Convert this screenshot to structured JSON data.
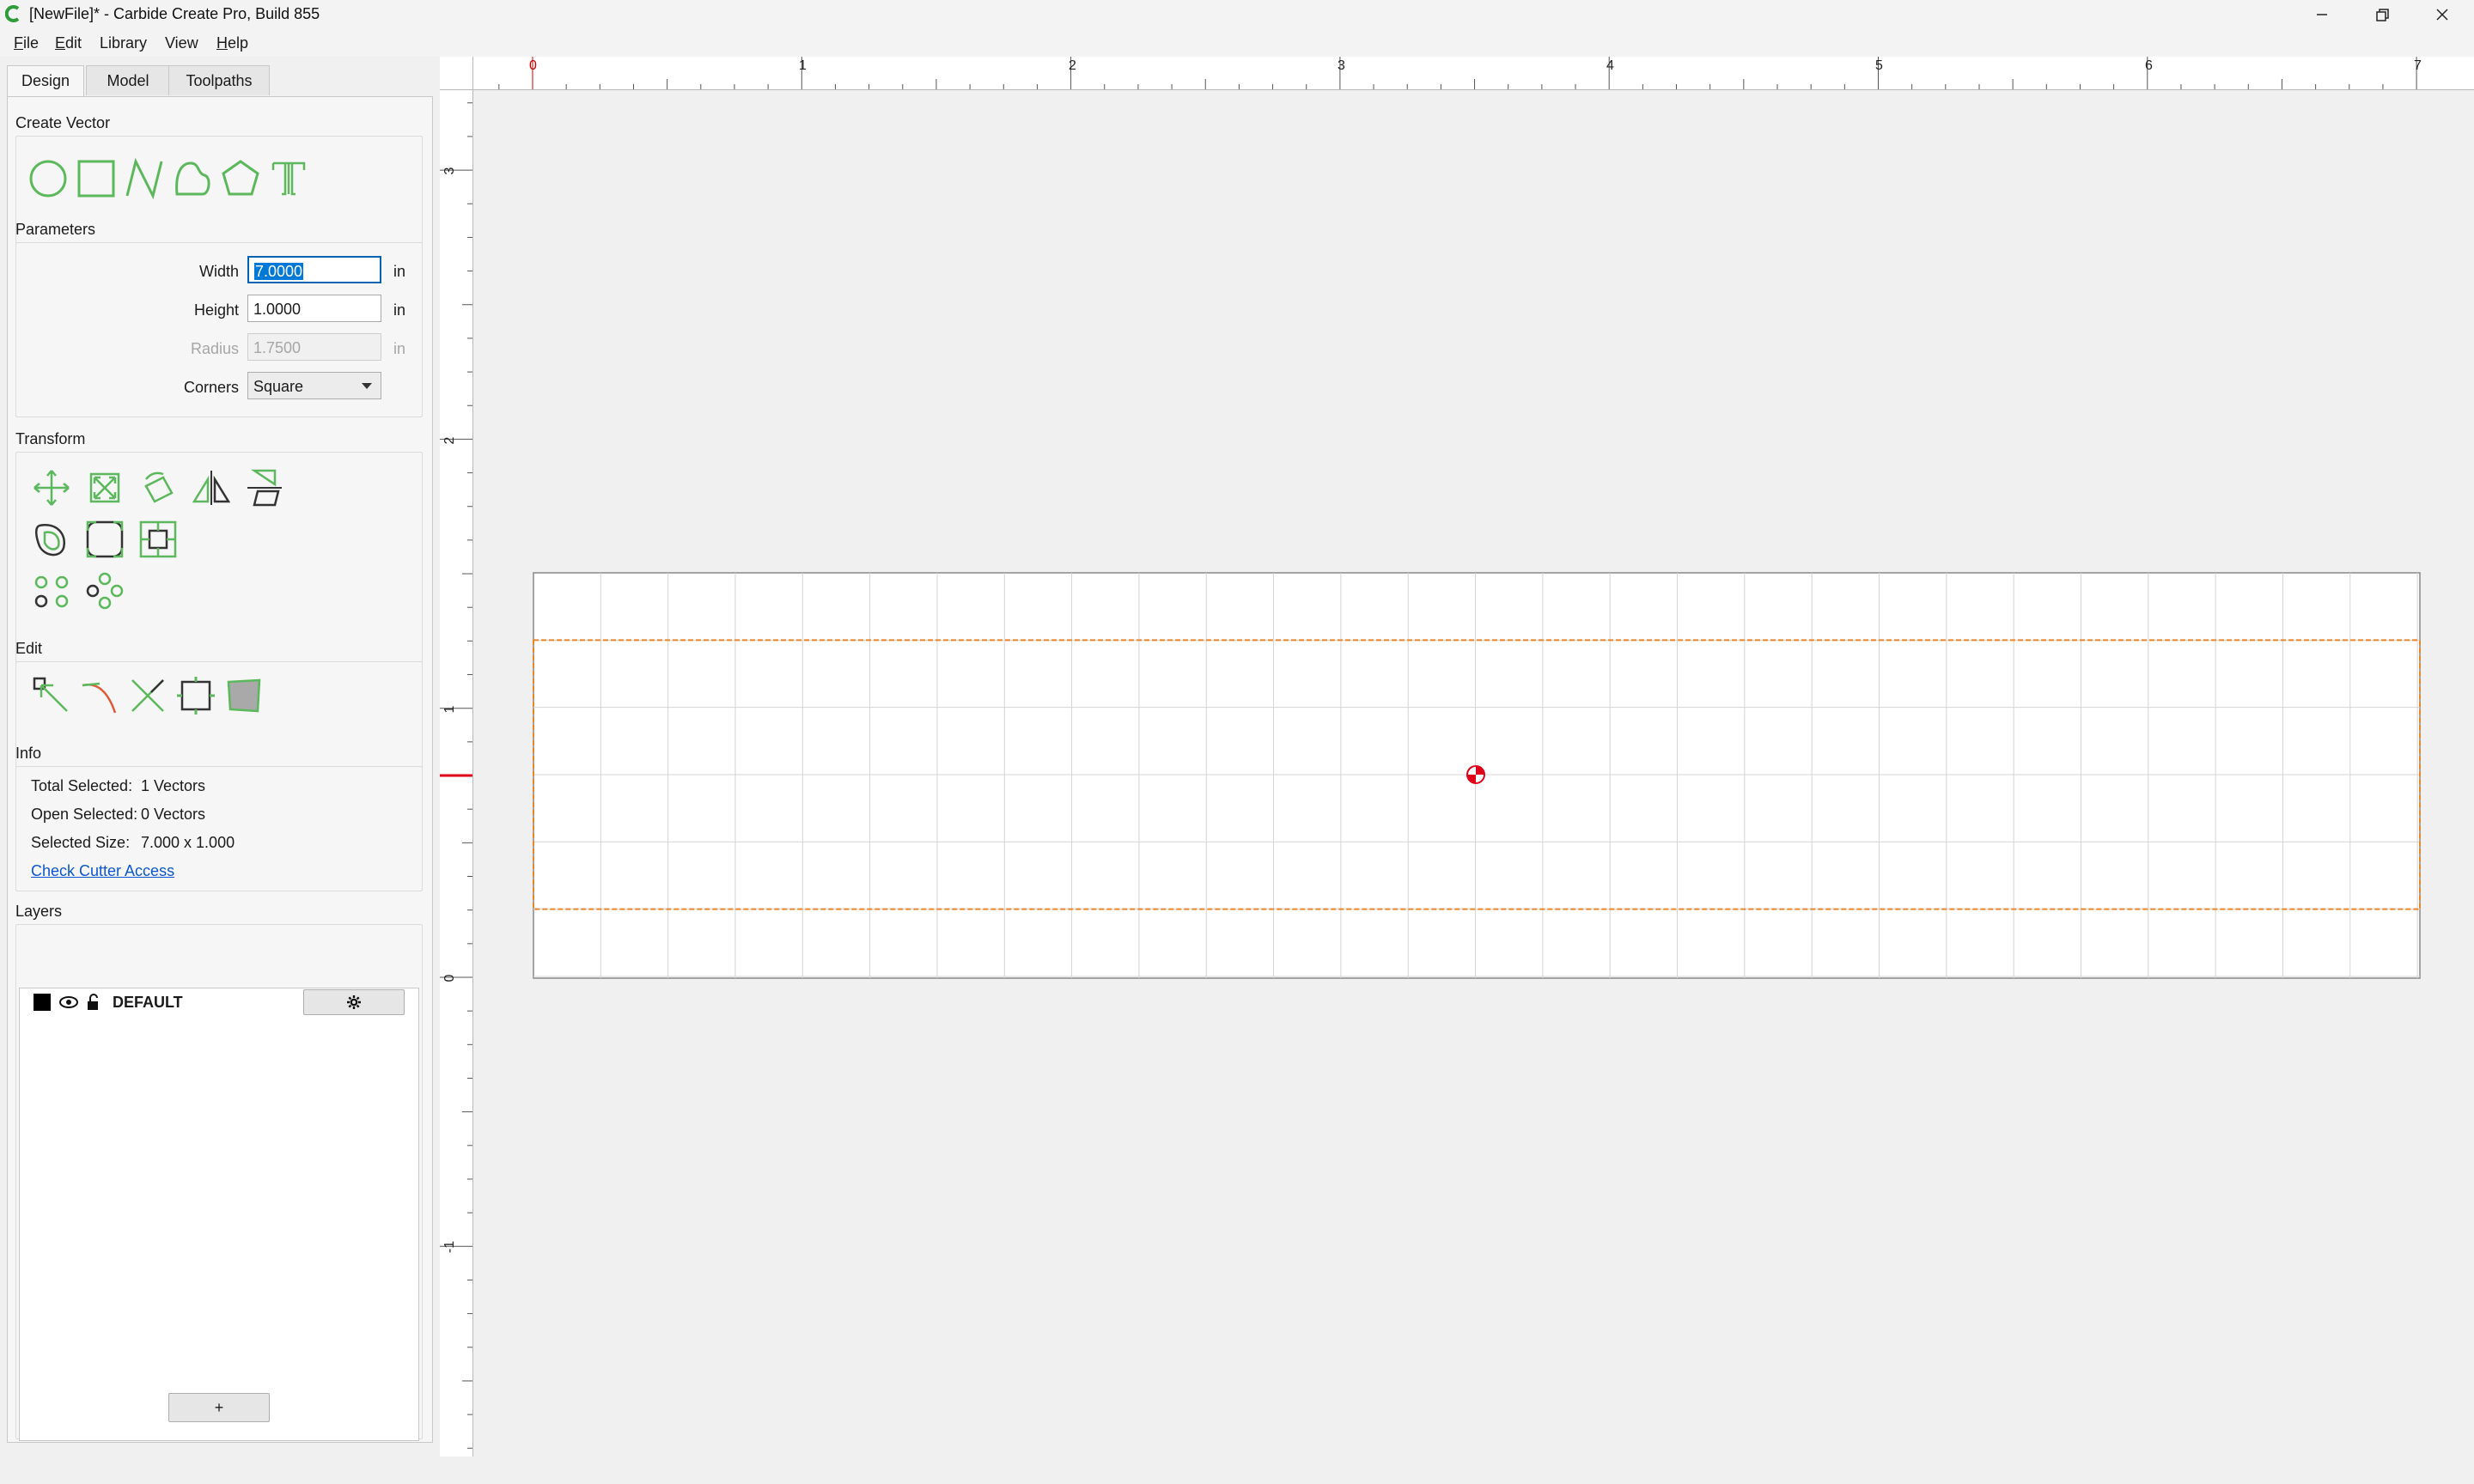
{
  "window": {
    "title": "[NewFile]* - Carbide Create Pro, Build 855",
    "app_icon": "carbide-c-logo",
    "buttons": [
      "minimize-icon",
      "restore-icon",
      "close-icon"
    ]
  },
  "menu": {
    "file": {
      "u": "F",
      "rest": "ile"
    },
    "edit": {
      "u": "E",
      "rest": "dit"
    },
    "library": "Library",
    "view": "View",
    "help": {
      "u": "H",
      "rest": "elp"
    }
  },
  "tabs": {
    "design": "Design",
    "model": "Model",
    "toolpaths": "Toolpaths"
  },
  "create_vector": {
    "label": "Create Vector",
    "tools": [
      "circle-icon",
      "rectangle-icon",
      "polyline-icon",
      "curve-icon",
      "polygon-icon",
      "text-icon"
    ]
  },
  "parameters": {
    "label": "Parameters",
    "width_label": "Width",
    "width_value": "7.0000",
    "width_unit": "in",
    "height_label": "Height",
    "height_value": "1.0000",
    "height_unit": "in",
    "radius_label": "Radius",
    "radius_value": "1.7500",
    "radius_unit": "in",
    "corners_label": "Corners",
    "corners_value": "Square"
  },
  "transform": {
    "label": "Transform"
  },
  "edit": {
    "label": "Edit"
  },
  "info": {
    "label": "Info",
    "total_selected_label": "Total Selected:",
    "total_selected_value": "1 Vectors",
    "open_selected_label": "Open Selected:",
    "open_selected_value": "0 Vectors",
    "selected_size_label": "Selected Size:",
    "selected_size_value": "7.000 x 1.000",
    "check_cutter_access": "Check Cutter Access"
  },
  "layers": {
    "label": "Layers",
    "items": [
      {
        "name": "DEFAULT",
        "color": "#000000"
      }
    ],
    "add_button": "+"
  },
  "rulers": {
    "top_labels": [
      "0",
      "1",
      "2",
      "3",
      "4",
      "5",
      "6",
      "7"
    ],
    "left_labels": [
      "3",
      "2",
      "1",
      "0",
      "-1"
    ]
  },
  "colors": {
    "accent_green": "#5cb85c",
    "selection_orange": "#e8862a",
    "origin_red": "#e0001a"
  }
}
